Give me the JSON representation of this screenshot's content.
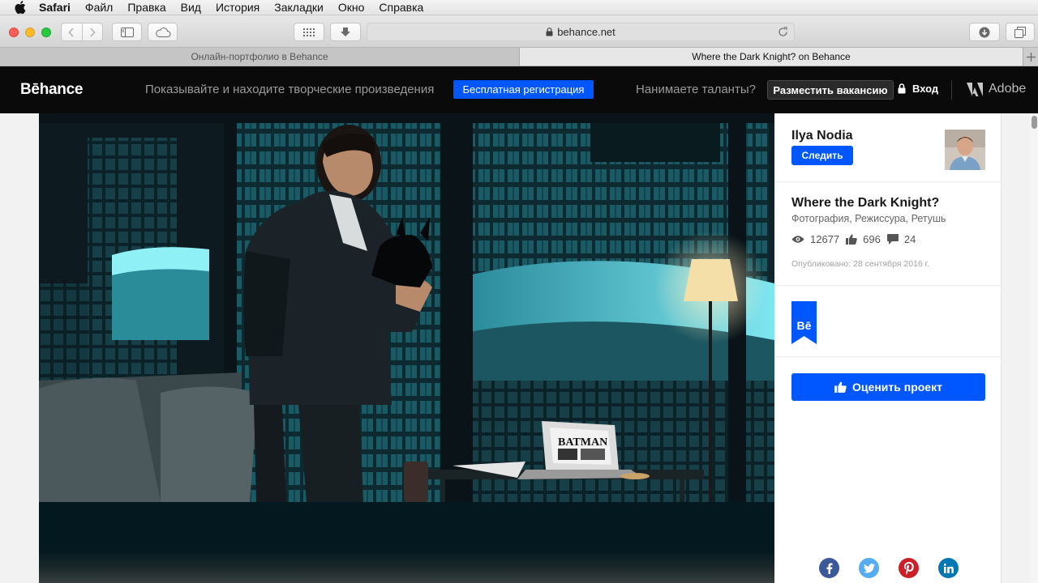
{
  "menubar": {
    "app_name": "Safari",
    "items": [
      "Файл",
      "Правка",
      "Вид",
      "История",
      "Закладки",
      "Окно",
      "Справка"
    ]
  },
  "browser": {
    "url": "behance.net",
    "tabs": [
      {
        "title": "Онлайн-портфолио в Behance",
        "active": false
      },
      {
        "title": "Where the Dark Knight? on Behance",
        "active": true
      }
    ]
  },
  "header": {
    "logo": "Bēhance",
    "slogan": "Показывайте и находите творческие произведения",
    "signup_label": "Бесплатная регистрация",
    "hire_text": "Нанимаете таланты?",
    "post_job_label": "Разместить вакансию",
    "login_label": "Вход",
    "adobe_label": "Adobe"
  },
  "project": {
    "owner": "Ilya Nodia",
    "follow_label": "Следить",
    "title": "Where the Dark Knight?",
    "fields": "Фотография, Режиссура, Ретушь",
    "views": "12677",
    "appreciations": "696",
    "comments": "24",
    "published": "Опубликовано: 28 сентября 2016 г.",
    "badge": "Bē",
    "appreciate_label": "Оценить проект",
    "newspaper_headline": "BATMAN"
  },
  "colors": {
    "behance_blue": "#0057ff",
    "header_bg": "#0a0a0a",
    "facebook": "#3b5998",
    "twitter": "#55acee",
    "pinterest": "#cb2027",
    "linkedin": "#0077b5"
  }
}
